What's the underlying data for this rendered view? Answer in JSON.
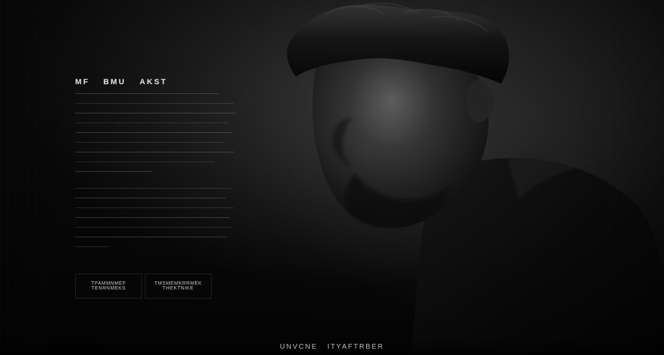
{
  "heading": {
    "word1": "MF",
    "word2": "BMU",
    "word3": "AKST"
  },
  "buttons": {
    "primary": "TPAMMNMEF TENRNMEKS",
    "secondary": "TMSMEMKRRMEK THEKTNIKE"
  },
  "footer": {
    "word1": "UNVCNE",
    "word2": "ITYAFTRBER"
  },
  "colors": {
    "background": "#0a0a0a",
    "text": "#e8e8e8"
  }
}
